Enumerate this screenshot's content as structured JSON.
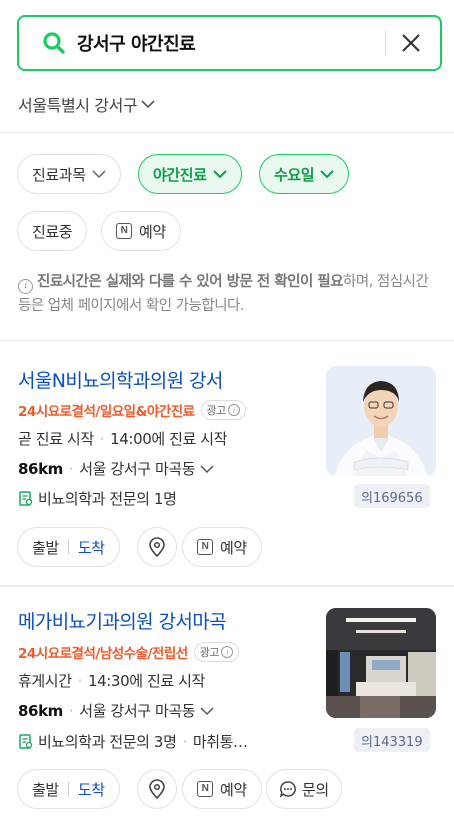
{
  "search": {
    "query": "강서구 야간진료"
  },
  "region": {
    "label": "서울특별시 강서구"
  },
  "filters": {
    "department": "진료과목",
    "night": "야간진료",
    "weekday": "수요일",
    "open_now": "진료중",
    "reserve": "예약"
  },
  "notice": {
    "bold": "진료시간은 실제와 다를 수 있어 방문 전 확인이 필요",
    "rest": "하며, 점심시간 등은 업체 페이지에서 확인 가능합니다."
  },
  "ad_label": "광고",
  "results": [
    {
      "name": "서울N비뇨의학과의원 강서",
      "tags": "24시요로결석/일요일&야간진료",
      "status": "곧 진료 시작",
      "time": "14:00에 진료 시작",
      "distance": "86km",
      "address": "서울 강서구 마곡동",
      "doctors": "비뇨의학과 전문의 1명",
      "extra": "",
      "review_count": "의169656",
      "actions": {
        "depart": "출발",
        "arrive": "도착",
        "reserve": "예약",
        "inquire": ""
      }
    },
    {
      "name": "메가비뇨기과의원 강서마곡",
      "tags": "24시요로결석/남성수술/전립선",
      "status": "휴게시간",
      "time": "14:30에 진료 시작",
      "distance": "86km",
      "address": "서울 강서구 마곡동",
      "doctors": "비뇨의학과 전문의 3명",
      "extra": "마취통…",
      "review_count": "의143319",
      "actions": {
        "depart": "출발",
        "arrive": "도착",
        "reserve": "예약",
        "inquire": "문의"
      }
    }
  ],
  "colors": {
    "accent_green": "#19ce60",
    "link_blue": "#0b4fc6",
    "tag_orange": "#f15a2b"
  }
}
